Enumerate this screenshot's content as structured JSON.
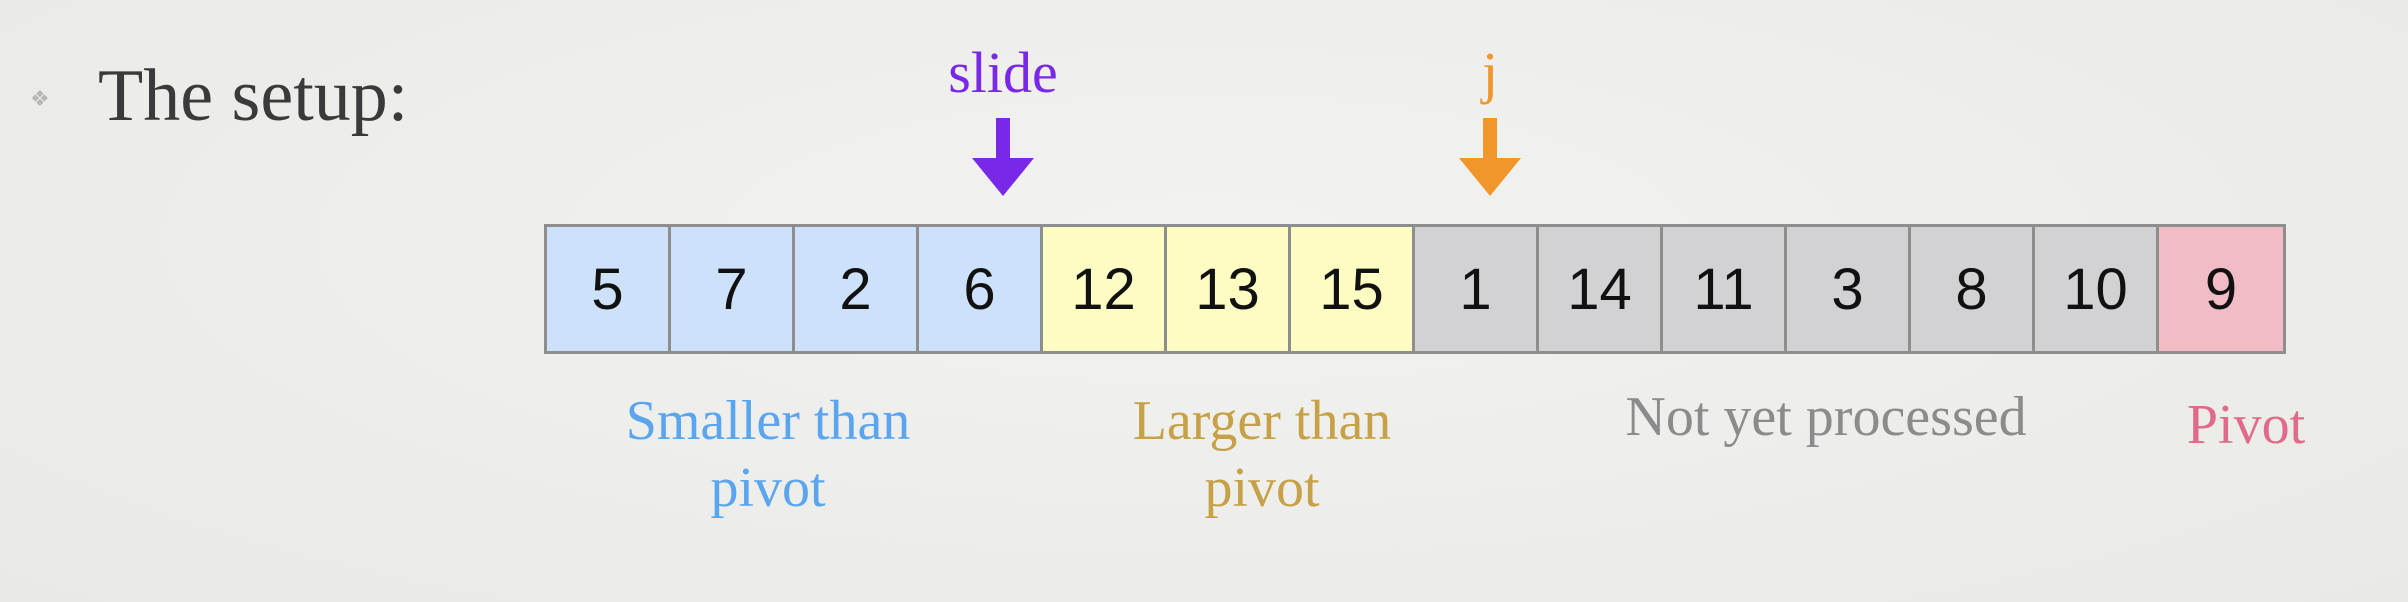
{
  "heading": {
    "bullet_icon": "diamond-bullet-icon",
    "text": "The setup:"
  },
  "pointers": {
    "slide": {
      "label": "slide",
      "color": "#7a28e8",
      "icon": "arrow-down-icon"
    },
    "j": {
      "label": "j",
      "color": "#f0962a",
      "icon": "arrow-down-icon"
    }
  },
  "array": {
    "cells": [
      {
        "value": "5",
        "group": "smaller"
      },
      {
        "value": "7",
        "group": "smaller"
      },
      {
        "value": "2",
        "group": "smaller"
      },
      {
        "value": "6",
        "group": "smaller"
      },
      {
        "value": "12",
        "group": "larger"
      },
      {
        "value": "13",
        "group": "larger"
      },
      {
        "value": "15",
        "group": "larger"
      },
      {
        "value": "1",
        "group": "unprocessed"
      },
      {
        "value": "14",
        "group": "unprocessed"
      },
      {
        "value": "11",
        "group": "unprocessed"
      },
      {
        "value": "3",
        "group": "unprocessed"
      },
      {
        "value": "8",
        "group": "unprocessed"
      },
      {
        "value": "10",
        "group": "unprocessed"
      },
      {
        "value": "9",
        "group": "pivot"
      }
    ],
    "group_colors": {
      "smaller": "#cde1fa",
      "larger": "#fdfcc2",
      "unprocessed": "#d2d1d4",
      "pivot": "#f2bcc6"
    }
  },
  "captions": {
    "smaller": {
      "lines": [
        "Smaller than",
        "pivot"
      ],
      "color": "#5aa5ee"
    },
    "larger": {
      "lines": [
        "Larger than",
        "pivot"
      ],
      "color": "#c6a147"
    },
    "unprocessed": {
      "lines": [
        "Not yet processed"
      ],
      "color": "#8b8b8b"
    },
    "pivot": {
      "lines": [
        "Pivot"
      ],
      "color": "#e06a8a"
    }
  }
}
